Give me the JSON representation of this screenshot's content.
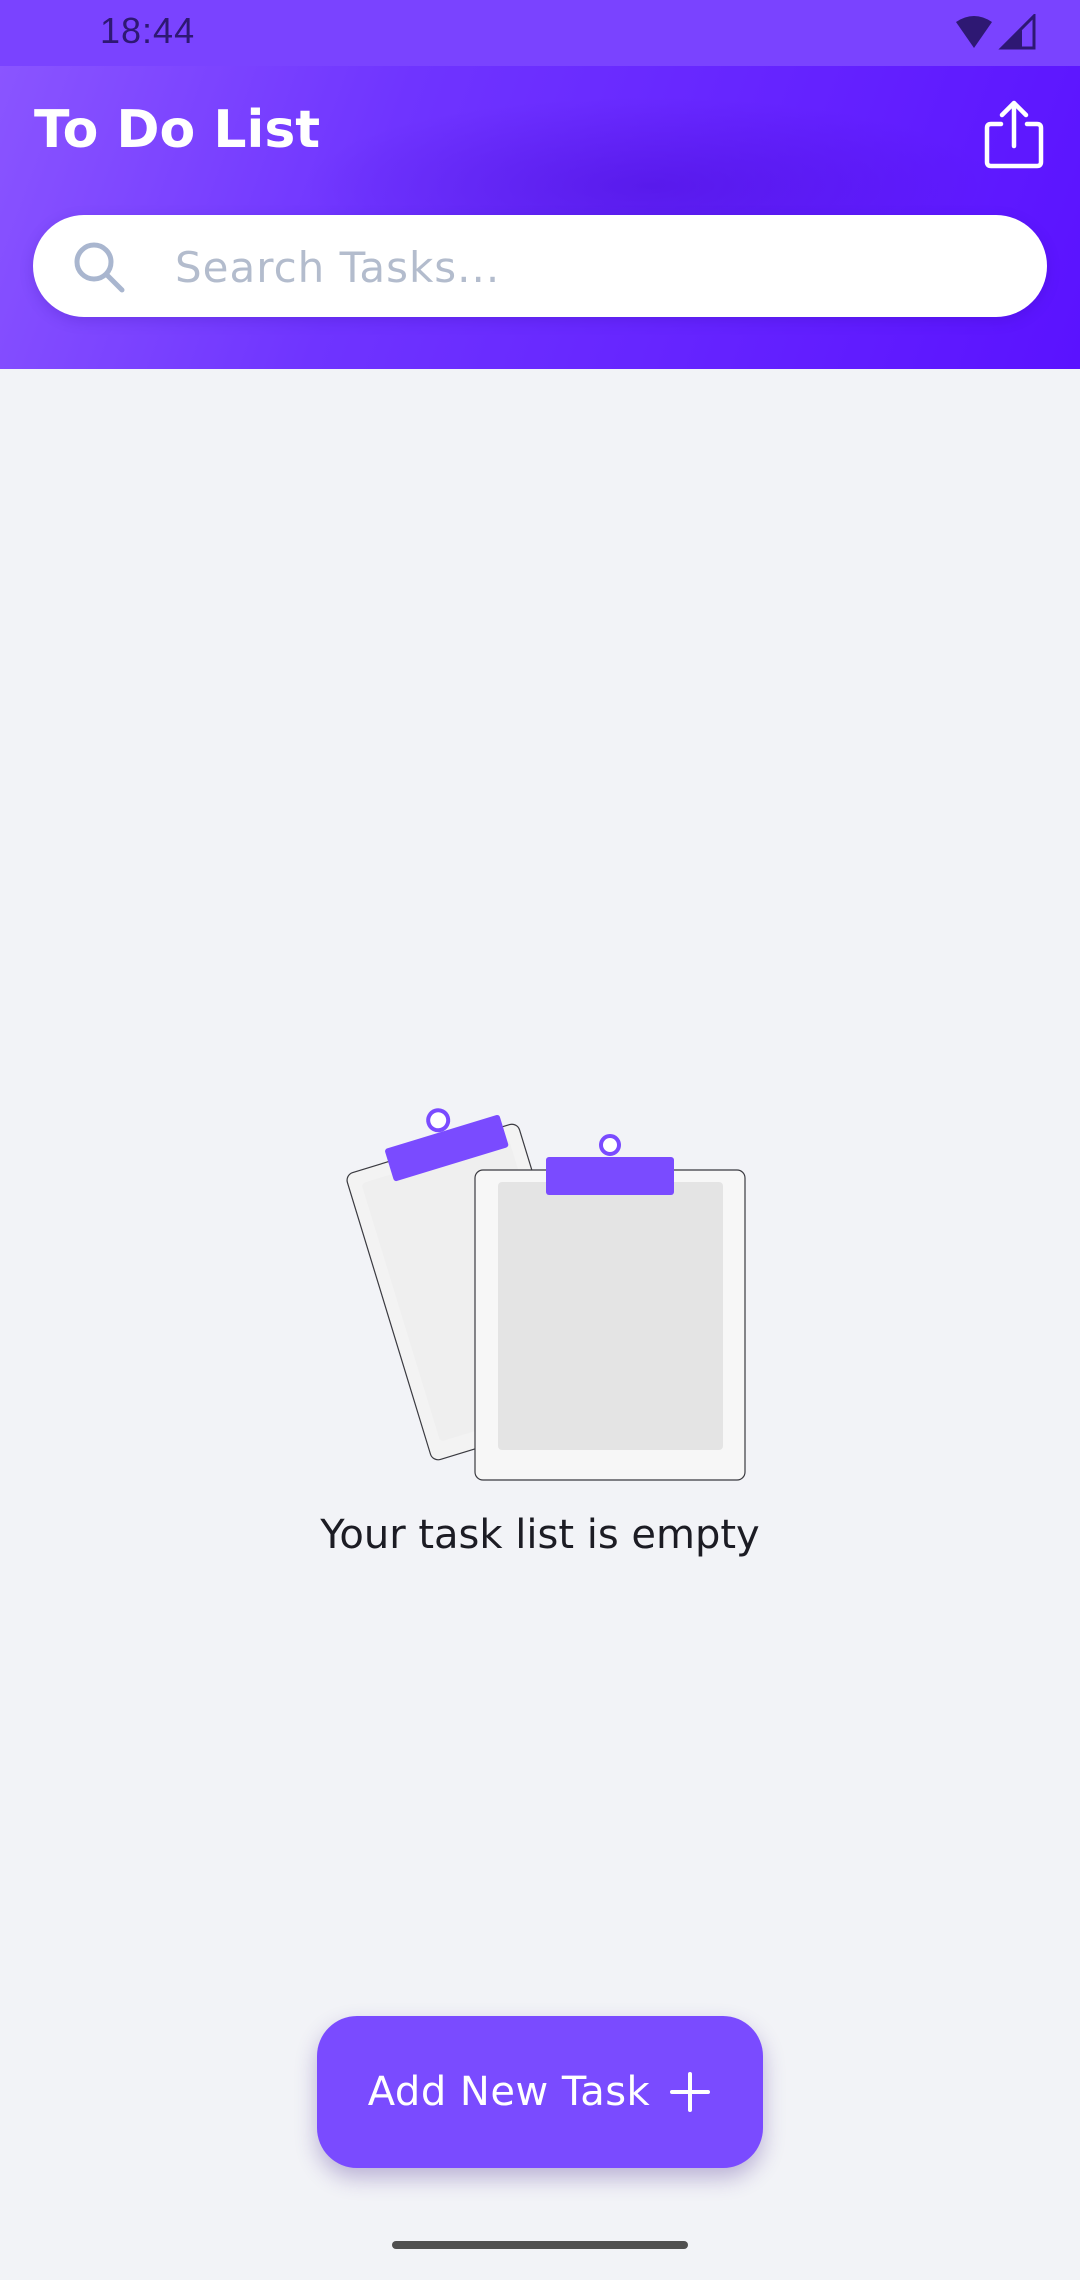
{
  "status_bar": {
    "time": "18:44",
    "icons": [
      "wifi-icon",
      "signal-icon"
    ],
    "color": "#7a43ff"
  },
  "header": {
    "title": "To Do List",
    "share_icon": "share-icon",
    "gradient": [
      "#8a55ff",
      "#5a12ff"
    ]
  },
  "search": {
    "placeholder": "Search Tasks...",
    "value": "",
    "icon": "search-icon"
  },
  "empty_state": {
    "illustration": "clipboards-icon",
    "message": "Your task list is empty"
  },
  "add_button": {
    "label": "Add New Task",
    "icon": "plus-icon",
    "color": "#7a4bff"
  },
  "colors": {
    "accent": "#7a4bff",
    "background": "#f2f3f7",
    "placeholder": "#b3bccd"
  }
}
